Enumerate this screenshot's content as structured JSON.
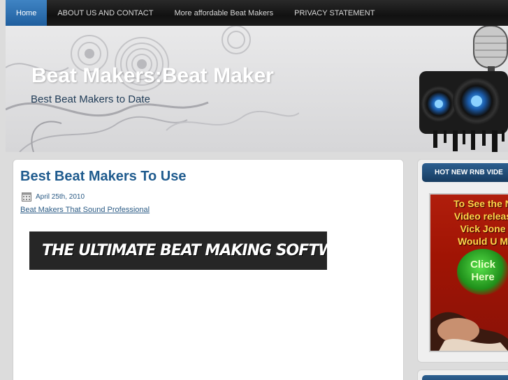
{
  "nav": {
    "items": [
      {
        "label": "Home",
        "active": true
      },
      {
        "label": "ABOUT US AND CONTACT",
        "active": false
      },
      {
        "label": "More affordable Beat Makers",
        "active": false
      },
      {
        "label": "PRIVACY STATEMENT",
        "active": false
      }
    ]
  },
  "header": {
    "title": "Beat Makers:Beat Maker",
    "description": "Best Beat Makers to Date"
  },
  "post": {
    "title": "Best Beat Makers To Use",
    "date": "April 25th, 2010",
    "link_text": "Beat Makers That Sound Professional",
    "banner_text": "THE ULTIMATE BEAT MAKING SOFTWARE"
  },
  "sidebar": {
    "widget_title": "HOT NEW RNB VIDE",
    "ad_text": "To See the N Video releas Vick Jone Would U M",
    "ad_lines": [
      "To See the N",
      "Video releas",
      "Vick Jone",
      "Would U M"
    ],
    "ad_click": [
      "Click",
      "Here"
    ]
  },
  "colors": {
    "nav_active": "#2f72b4",
    "title_blue": "#1f5b8e",
    "sidebar_head": "#234d78",
    "ad_red": "#a01404",
    "ad_yellow": "#ffd64a"
  }
}
